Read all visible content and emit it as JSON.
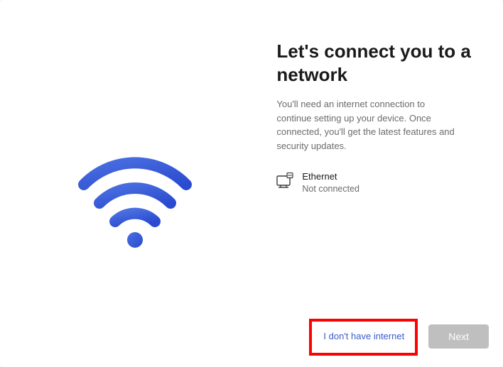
{
  "title": "Let's connect you to a network",
  "description": "You'll need an internet connection to continue setting up your device. Once connected, you'll get the latest features and security updates.",
  "connection": {
    "name": "Ethernet",
    "status": "Not connected"
  },
  "buttons": {
    "no_internet": "I don't have internet",
    "next": "Next"
  }
}
